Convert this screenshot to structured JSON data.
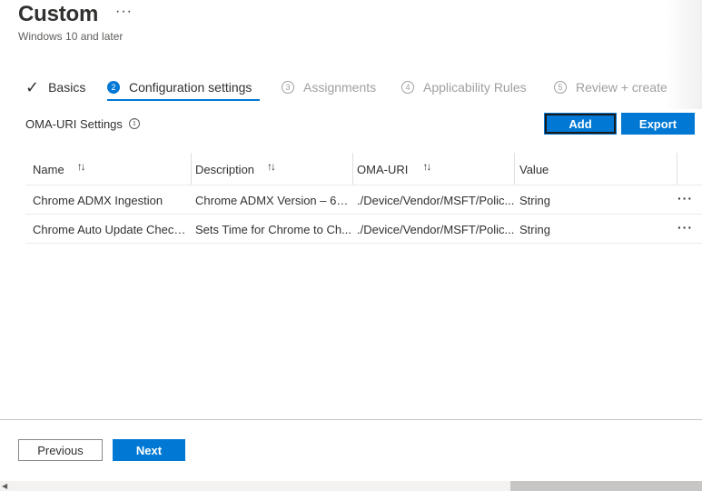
{
  "header": {
    "title": "Custom",
    "more_icon": "···",
    "subtitle": "Windows 10 and later"
  },
  "wizard": {
    "steps": [
      {
        "number": "",
        "label": "Basics",
        "state": "done"
      },
      {
        "number": "2",
        "label": "Configuration settings",
        "state": "active"
      },
      {
        "number": "3",
        "label": "Assignments",
        "state": "disabled"
      },
      {
        "number": "4",
        "label": "Applicability Rules",
        "state": "disabled"
      },
      {
        "number": "5",
        "label": "Review + create",
        "state": "disabled"
      }
    ],
    "check_icon": "✓"
  },
  "oma": {
    "label": "OMA-URI Settings",
    "info_icon": "i",
    "add_label": "Add",
    "export_label": "Export"
  },
  "table": {
    "columns": [
      "Name",
      "Description",
      "OMA-URI",
      "Value"
    ],
    "sort_icon": "↑↓",
    "rows": [
      {
        "name": "Chrome ADMX Ingestion",
        "description": "Chrome ADMX Version – 68...",
        "oma_uri": "./Device/Vendor/MSFT/Polic...",
        "value": "String"
      },
      {
        "name": "Chrome Auto Update Check...",
        "description": "Sets Time for Chrome to Ch...",
        "oma_uri": "./Device/Vendor/MSFT/Polic...",
        "value": "String"
      }
    ],
    "row_more_icon": "···"
  },
  "footer": {
    "previous_label": "Previous",
    "next_label": "Next"
  },
  "colors": {
    "accent": "#0078d4",
    "text": "#323130",
    "disabled": "#a19f9d"
  }
}
